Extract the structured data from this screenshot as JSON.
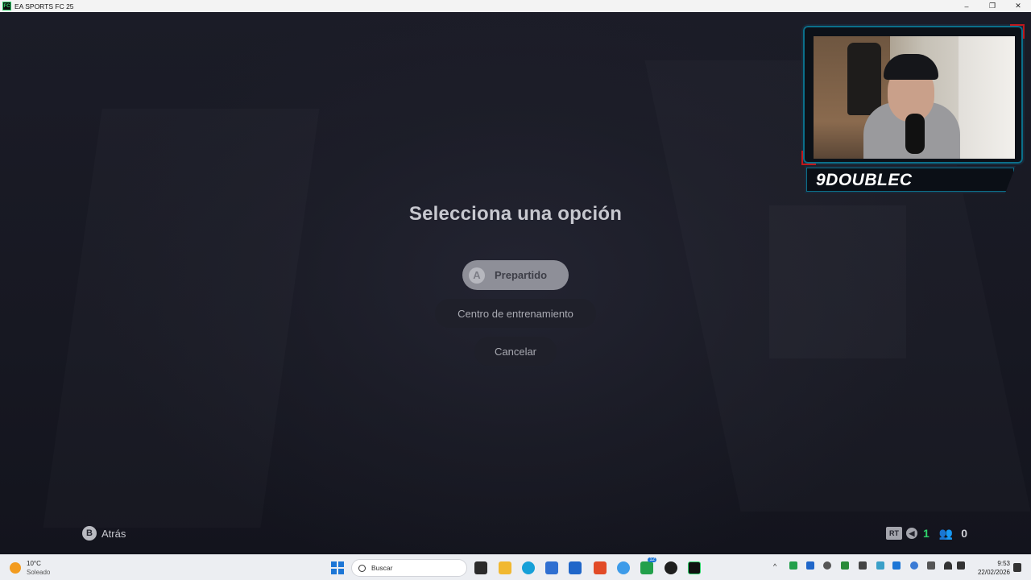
{
  "window": {
    "title": "EA SPORTS FC 25",
    "controls": {
      "minimize": "–",
      "restore": "❐",
      "close": "✕"
    }
  },
  "dialog": {
    "heading": "Selecciona una opción",
    "options": [
      {
        "label": "Prepartido",
        "button_glyph": "A",
        "selected": true
      },
      {
        "label": "Centro de entrenamiento",
        "selected": false
      },
      {
        "label": "Cancelar",
        "selected": false
      }
    ]
  },
  "footer": {
    "back_glyph": "B",
    "back_label": "Atrás"
  },
  "hud": {
    "rt_label": "RT",
    "voice_count": "1",
    "party_count": "0",
    "accent_color": "#2fd36b"
  },
  "webcam": {
    "streamer_name": "9DOUBLEC"
  },
  "taskbar": {
    "weather_temp": "10°C",
    "weather_desc": "Soleado",
    "search_placeholder": "Buscar",
    "edge_badge": "12",
    "time": "9:53",
    "date": "22/02/2026"
  }
}
